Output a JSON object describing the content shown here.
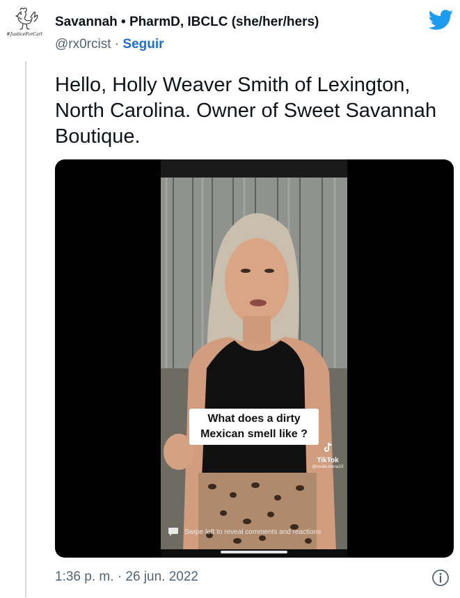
{
  "author": {
    "name": "Savannah • PharmD, IBCLC (she/her/hers)",
    "handle": "@rx0rcist",
    "separator": "·",
    "follow_label": "Seguir",
    "avatar_text": "#JusticeForCarl",
    "avatar_icon": "rooster-icon"
  },
  "tweet": {
    "text": "Hello, Holly Weaver Smith of Lexington, North Carolina. Owner of Sweet Savannah Boutique."
  },
  "media": {
    "caption_line1": "What does a dirty",
    "caption_line2": "Mexican smell like ?",
    "tiktok_label": "TikTok",
    "tiktok_user": "@leslie.loera19",
    "swipe_hint": "Swipe left to reveal comments and reactions"
  },
  "footer": {
    "time": "1:36 p. m.",
    "separator": "·",
    "date": "26 jun. 2022",
    "info_icon": "info-icon"
  },
  "colors": {
    "twitter_blue": "#1d9bf0",
    "link_blue": "#1d6fc9",
    "muted": "#536471"
  }
}
